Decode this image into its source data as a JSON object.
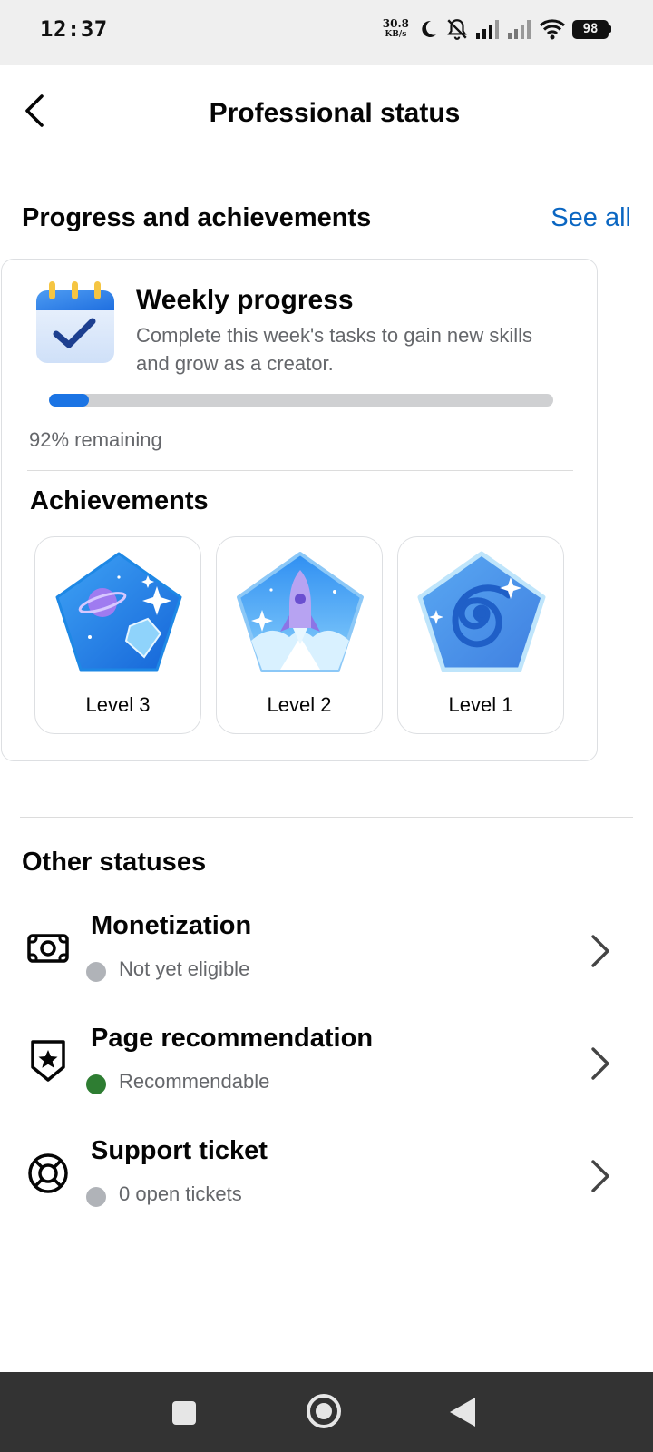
{
  "status_bar": {
    "time": "12:37",
    "net_speed_value": "30.8",
    "net_speed_unit": "KB/s",
    "battery": "98",
    "icons": [
      "moon-icon",
      "bell-off-icon",
      "signal-icon",
      "signal-icon",
      "wifi-icon",
      "battery-icon"
    ]
  },
  "header": {
    "title": "Professional status",
    "back_icon": "chevron-left-icon"
  },
  "progress_section": {
    "heading": "Progress and achievements",
    "see_all": "See all"
  },
  "weekly": {
    "icon": "calendar-check-icon",
    "title": "Weekly progress",
    "description": "Complete this week's tasks to gain new skills and grow as a creator.",
    "progress_fraction": 0.08,
    "remaining_text": "92% remaining"
  },
  "achievements": {
    "heading": "Achievements",
    "badges": [
      {
        "label": "Level 3",
        "icon": "planet-diamond-badge"
      },
      {
        "label": "Level 2",
        "icon": "rocket-badge"
      },
      {
        "label": "Level 1",
        "icon": "galaxy-badge"
      }
    ]
  },
  "other": {
    "heading": "Other statuses",
    "rows": [
      {
        "title": "Monetization",
        "status": "Not yet eligible",
        "status_color": "#b0b3b8",
        "icon": "money-icon"
      },
      {
        "title": "Page recommendation",
        "status": "Recommendable",
        "status_color": "#2e7d32",
        "icon": "shield-star-icon"
      },
      {
        "title": "Support ticket",
        "status": "0 open tickets",
        "status_color": "#b0b3b8",
        "icon": "lifebuoy-icon"
      }
    ]
  },
  "colors": {
    "accent": "#1b74e4",
    "link": "#0a66c2"
  }
}
